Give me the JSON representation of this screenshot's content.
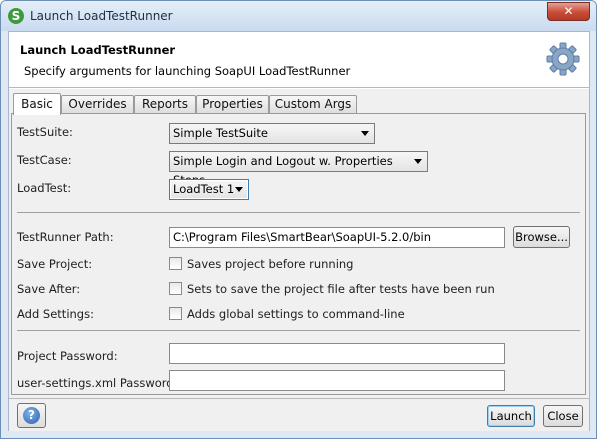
{
  "window": {
    "title": "Launch LoadTestRunner",
    "close_symbol": "✕"
  },
  "header": {
    "title": "Launch LoadTestRunner",
    "subtitle": "Specify arguments for launching SoapUI LoadTestRunner",
    "icon": "gear-icon"
  },
  "tabs": [
    {
      "label": "Basic",
      "active": true
    },
    {
      "label": "Overrides"
    },
    {
      "label": "Reports"
    },
    {
      "label": "Properties"
    },
    {
      "label": "Custom Args"
    }
  ],
  "form": {
    "testsuite_label": "TestSuite:",
    "testsuite_value": "Simple TestSuite",
    "testcase_label": "TestCase:",
    "testcase_value": "Simple Login and Logout w. Properties Steps",
    "loadtest_label": "LoadTest:",
    "loadtest_value": "LoadTest 1",
    "runner_path_label": "TestRunner Path:",
    "runner_path_value": "C:\\Program Files\\SmartBear\\SoapUI-5.2.0/bin",
    "browse_label": "Browse...",
    "save_project_label": "Save Project:",
    "save_project_text": "Saves project before running",
    "save_after_label": "Save After:",
    "save_after_text": "Sets to save the project file after tests have been run",
    "add_settings_label": "Add Settings:",
    "add_settings_text": "Adds global settings to command-line",
    "project_password_label": "Project Password:",
    "project_password_value": "",
    "settings_password_label": "user-settings.xml Password:",
    "settings_password_value": ""
  },
  "footer": {
    "help_symbol": "?",
    "launch_label": "Launch",
    "close_label": "Close"
  },
  "colors": {
    "accent": "#3c7fb1",
    "titlebar": "#c9dbef",
    "close_button": "#c74c37",
    "app_icon": "#3f9a3f"
  }
}
